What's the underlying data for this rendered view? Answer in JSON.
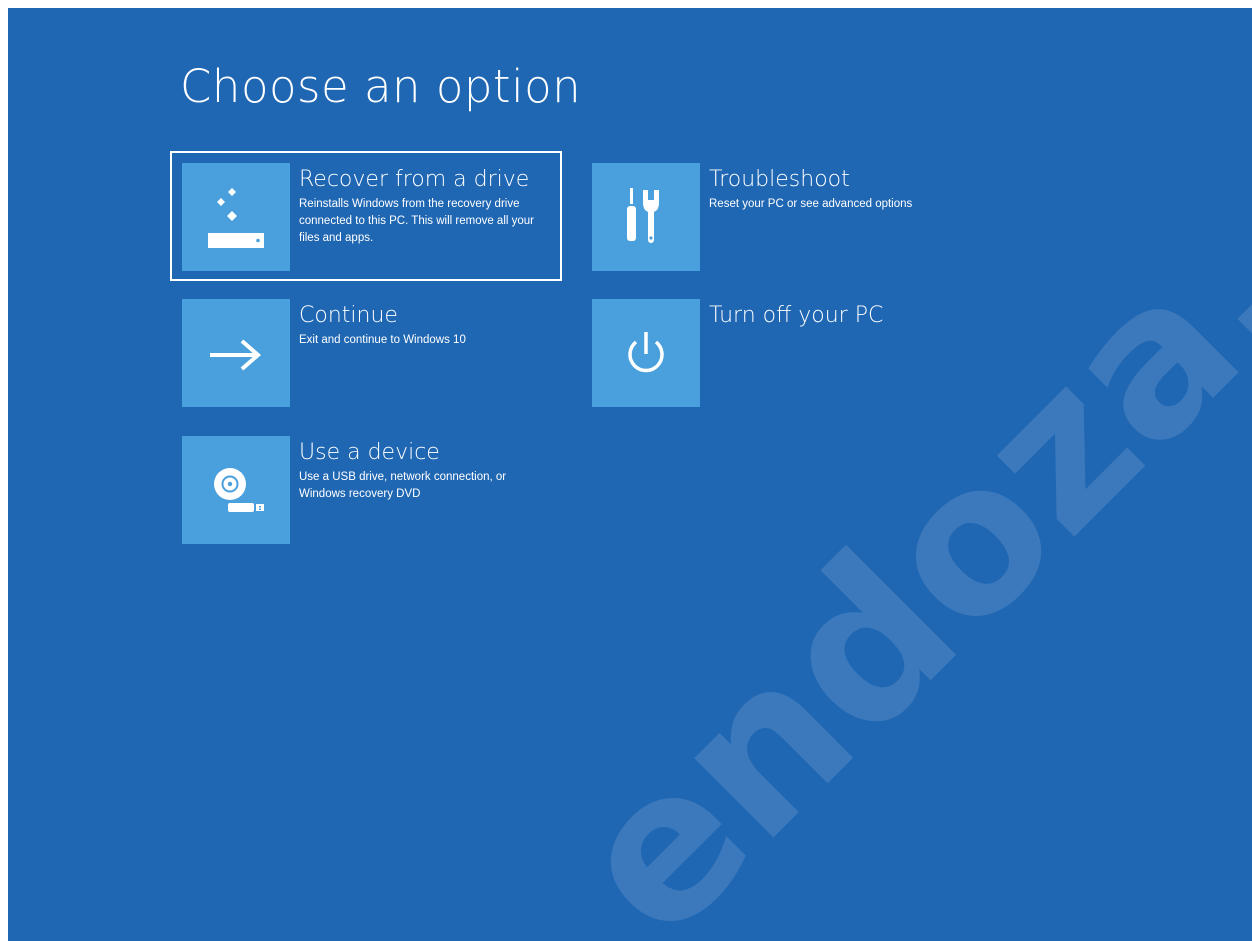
{
  "title": "Choose an option",
  "options": [
    {
      "heading": "Recover from a drive",
      "description": "Reinstalls Windows from the recovery drive connected to this PC. This will remove all your files and apps.",
      "icon": "recover-drive-icon",
      "selected": true
    },
    {
      "heading": "Troubleshoot",
      "description": "Reset your PC or see advanced options",
      "icon": "tools-icon",
      "selected": false
    },
    {
      "heading": "Continue",
      "description": "Exit and continue to Windows 10",
      "icon": "arrow-right-icon",
      "selected": false
    },
    {
      "heading": "Turn off your PC",
      "description": "",
      "icon": "power-icon",
      "selected": false
    },
    {
      "heading": "Use a device",
      "description": "Use a USB drive, network connection, or Windows recovery DVD",
      "icon": "disc-usb-icon",
      "selected": false
    }
  ],
  "watermark": "endoza.com",
  "colors": {
    "background": "#2067b3",
    "tile": "#4aa0dc",
    "text": "#ffffff"
  }
}
